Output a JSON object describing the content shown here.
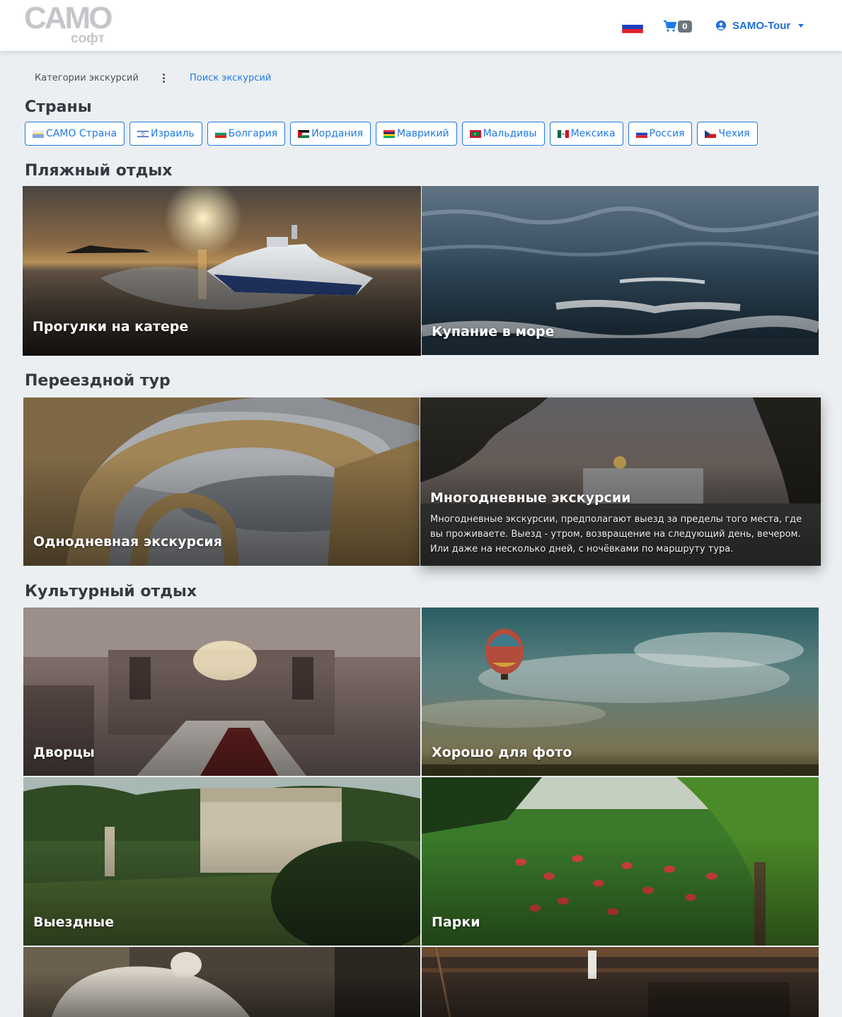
{
  "header": {
    "logo_main": "CAMO",
    "logo_sub": "софт",
    "cart_count": "0",
    "user_name": "SAMO-Tour",
    "language_flag": "russia-flag"
  },
  "nav": {
    "categories_label": "Категории экскурсий",
    "search_link": "Поиск экскурсий"
  },
  "countries": {
    "title": "Страны",
    "items": [
      {
        "label": "САМО Страна",
        "flag": "samo-flag"
      },
      {
        "label": "Израиль",
        "flag": "israel-flag"
      },
      {
        "label": "Болгария",
        "flag": "bulgaria-flag"
      },
      {
        "label": "Иордания",
        "flag": "jordan-flag"
      },
      {
        "label": "Маврикий",
        "flag": "mauritius-flag"
      },
      {
        "label": "Мальдивы",
        "flag": "maldives-flag"
      },
      {
        "label": "Мексика",
        "flag": "mexico-flag"
      },
      {
        "label": "Россия",
        "flag": "russia-flag"
      },
      {
        "label": "Чехия",
        "flag": "czech-flag"
      }
    ]
  },
  "sections": [
    {
      "title": "Пляжный отдых",
      "cards": [
        {
          "label": "Прогулки на катере"
        },
        {
          "label": "Купание в море"
        }
      ]
    },
    {
      "title": "Переездной тур",
      "cards": [
        {
          "label": "Однодневная экскурсия"
        },
        {
          "label": "Многодневные экскурсии",
          "description": "Многодневные экскурсии, предполагают выезд за пределы того места, где вы проживаете. Выезд - утром, возвращение на следующий день, вечером. Или даже на несколько дней, с ночёвками по маршруту тура."
        }
      ]
    },
    {
      "title": "Культурный отдых",
      "cards": [
        {
          "label": "Дворцы"
        },
        {
          "label": "Хорошо для фото"
        },
        {
          "label": "Выездные"
        },
        {
          "label": "Парки"
        },
        {
          "label": ""
        },
        {
          "label": ""
        }
      ]
    }
  ],
  "colors": {
    "accent": "#1e7ae6",
    "page_bg": "#eceff2",
    "badge": "#6c757d"
  }
}
